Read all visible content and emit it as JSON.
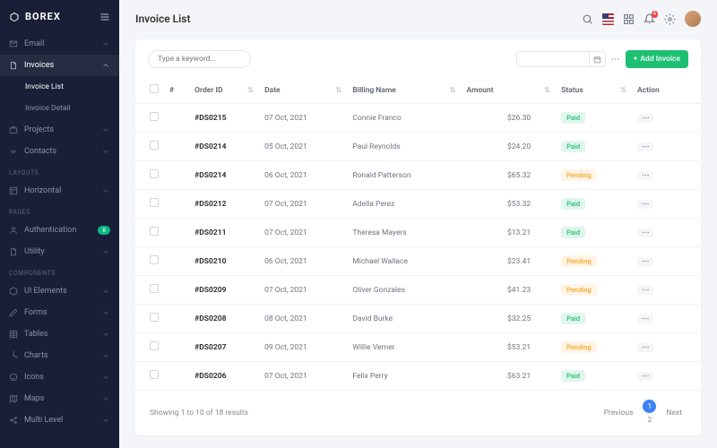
{
  "brand": "BOREX",
  "sidebar": {
    "items": [
      {
        "label": "Email",
        "icon": "mail"
      },
      {
        "label": "Invoices",
        "icon": "file",
        "active": true,
        "expanded": true,
        "sub": [
          {
            "label": "Invoice List",
            "active": true
          },
          {
            "label": "Invoice Detail"
          }
        ]
      },
      {
        "label": "Projects",
        "icon": "briefcase"
      },
      {
        "label": "Contacts",
        "icon": "wifi"
      }
    ],
    "layouts_label": "LAYOUTS",
    "layouts": [
      {
        "label": "Horizontal",
        "icon": "layout"
      }
    ],
    "pages_label": "PAGES",
    "pages": [
      {
        "label": "Authentication",
        "icon": "user",
        "badge": "8"
      },
      {
        "label": "Utility",
        "icon": "doc"
      }
    ],
    "components_label": "COMPONENTS",
    "components": [
      {
        "label": "UI Elements",
        "icon": "box"
      },
      {
        "label": "Forms",
        "icon": "edit"
      },
      {
        "label": "Tables",
        "icon": "table"
      },
      {
        "label": "Charts",
        "icon": "pie"
      },
      {
        "label": "Icons",
        "icon": "smile"
      },
      {
        "label": "Maps",
        "icon": "map"
      },
      {
        "label": "Multi Level",
        "icon": "share"
      }
    ]
  },
  "page_title": "Invoice List",
  "topbar": {
    "notif_count": "4"
  },
  "card": {
    "search_placeholder": "Type a keyword...",
    "add_button": "Add Invoice",
    "columns": {
      "hash": "#",
      "order_id": "Order ID",
      "date": "Date",
      "billing_name": "Billing Name",
      "amount": "Amount",
      "status": "Status",
      "action": "Action"
    },
    "rows": [
      {
        "id": "#DS0215",
        "date": "07 Oct, 2021",
        "name": "Connie Franco",
        "amount": "$26.30",
        "status": "Paid"
      },
      {
        "id": "#DS0214",
        "date": "05 Oct, 2021",
        "name": "Paul Reynolds",
        "amount": "$24.20",
        "status": "Paid"
      },
      {
        "id": "#DS0214",
        "date": "06 Oct, 2021",
        "name": "Ronald Patterson",
        "amount": "$65.32",
        "status": "Pending"
      },
      {
        "id": "#DS0212",
        "date": "07 Oct, 2021",
        "name": "Adella Perez",
        "amount": "$53.32",
        "status": "Paid"
      },
      {
        "id": "#DS0211",
        "date": "07 Oct, 2021",
        "name": "Theresa Mayers",
        "amount": "$13.21",
        "status": "Paid"
      },
      {
        "id": "#DS0210",
        "date": "06 Oct, 2021",
        "name": "Michael Wallace",
        "amount": "$23.41",
        "status": "Pending"
      },
      {
        "id": "#DS0209",
        "date": "07 Oct, 2021",
        "name": "Oliver Gonzales",
        "amount": "$41.23",
        "status": "Pending"
      },
      {
        "id": "#DS0208",
        "date": "08 Oct, 2021",
        "name": "David Burke",
        "amount": "$32.25",
        "status": "Paid"
      },
      {
        "id": "#DS0207",
        "date": "09 Oct, 2021",
        "name": "Willie Verner",
        "amount": "$53.21",
        "status": "Pending"
      },
      {
        "id": "#DS0206",
        "date": "07 Oct, 2021",
        "name": "Felix Perry",
        "amount": "$63.21",
        "status": "Paid"
      }
    ],
    "footer": {
      "showing": "Showing 1 to 10 of 18 results",
      "prev": "Previous",
      "next": "Next",
      "pages": [
        "1",
        "2"
      ],
      "active": "1"
    }
  }
}
